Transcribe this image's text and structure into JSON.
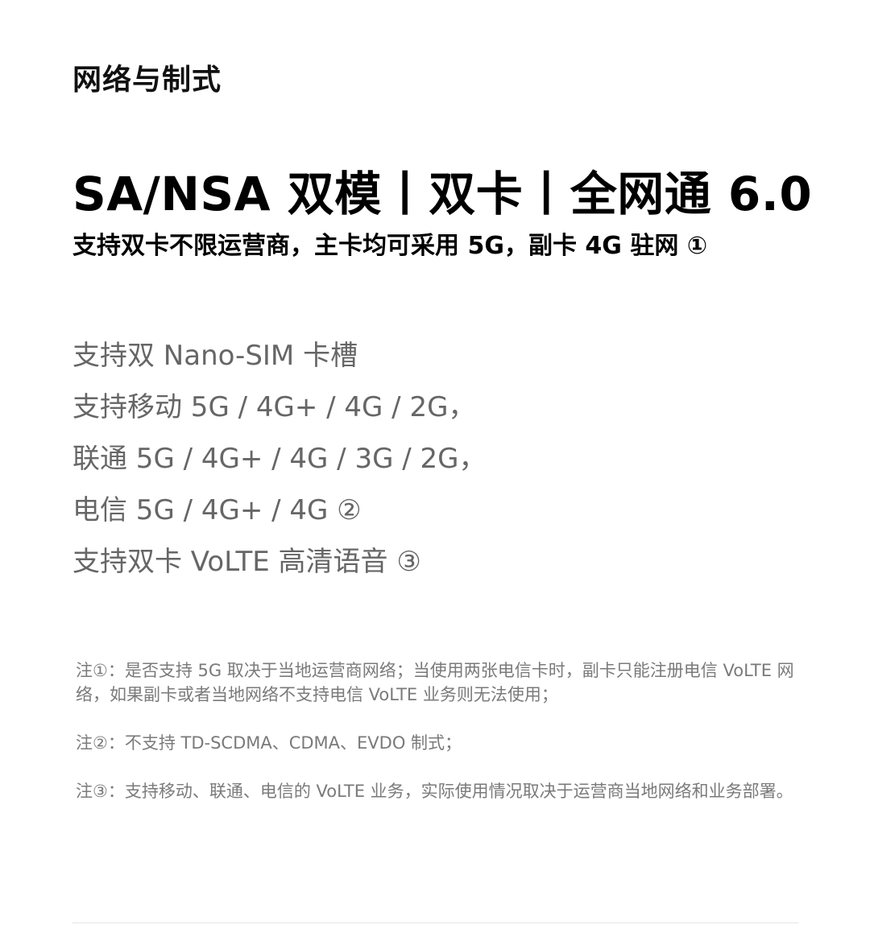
{
  "section": {
    "title": "网络与制式"
  },
  "headline": "SA/NSA 双模丨双卡丨全网通 6.0",
  "subheadline": "支持双卡不限运营商，主卡均可采用 5G，副卡 4G 驻网 ①",
  "features": [
    "支持双 Nano-SIM 卡槽",
    "支持移动 5G / 4G+ / 4G / 2G，",
    "联通 5G / 4G+ / 4G / 3G / 2G，",
    "电信 5G / 4G+ / 4G ②",
    "支持双卡 VoLTE 高清语音 ③"
  ],
  "notes": [
    "注①：是否支持 5G 取决于当地运营商网络；当使用两张电信卡时，副卡只能注册电信 VoLTE 网络，如果副卡或者当地网络不支持电信 VoLTE 业务则无法使用；",
    "注②：不支持 TD-SCDMA、CDMA、EVDO 制式；",
    "注③：支持移动、联通、电信的 VoLTE 业务，实际使用情况取决于运营商当地网络和业务部署。"
  ]
}
